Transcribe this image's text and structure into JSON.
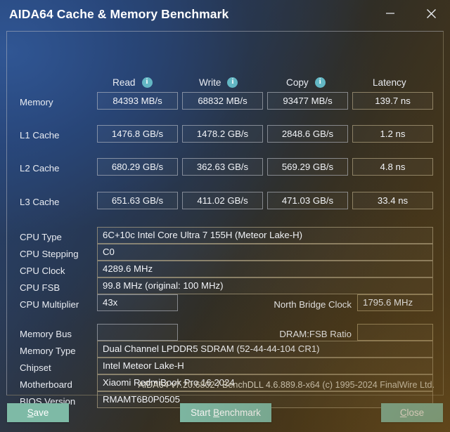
{
  "window": {
    "title": "AIDA64 Cache & Memory Benchmark",
    "minimize_label": "Minimize",
    "close_label": "Close"
  },
  "results_table": {
    "columns": [
      {
        "label": "Read",
        "icon": "info-icon",
        "icon_glyph": "i"
      },
      {
        "label": "Write",
        "icon": "info-icon",
        "icon_glyph": "i"
      },
      {
        "label": "Copy",
        "icon": "info-icon",
        "icon_glyph": "i"
      },
      {
        "label": "Latency",
        "icon": null,
        "icon_glyph": ""
      }
    ],
    "rows": [
      {
        "label": "Memory",
        "read": "84393 MB/s",
        "write": "68832 MB/s",
        "copy": "93477 MB/s",
        "latency": "139.7 ns"
      },
      {
        "label": "L1 Cache",
        "read": "1476.8 GB/s",
        "write": "1478.2 GB/s",
        "copy": "2848.6 GB/s",
        "latency": "1.2 ns"
      },
      {
        "label": "L2 Cache",
        "read": "680.29 GB/s",
        "write": "362.63 GB/s",
        "copy": "569.29 GB/s",
        "latency": "4.8 ns"
      },
      {
        "label": "L3 Cache",
        "read": "651.63 GB/s",
        "write": "411.02 GB/s",
        "copy": "471.03 GB/s",
        "latency": "33.4 ns"
      }
    ]
  },
  "cpu_info": {
    "cpu_type_label": "CPU Type",
    "cpu_type_value": "6C+10c Intel Core Ultra 7 155H  (Meteor Lake-H)",
    "cpu_stepping_label": "CPU Stepping",
    "cpu_stepping_value": "C0",
    "cpu_clock_label": "CPU Clock",
    "cpu_clock_value": "4289.6 MHz",
    "cpu_fsb_label": "CPU FSB",
    "cpu_fsb_value": "99.8 MHz  (original: 100 MHz)",
    "cpu_multiplier_label": "CPU Multiplier",
    "cpu_multiplier_value": "43x",
    "north_bridge_clock_label": "North Bridge Clock",
    "north_bridge_clock_value": "1795.6 MHz"
  },
  "memory_info": {
    "memory_bus_label": "Memory Bus",
    "memory_bus_value": "",
    "dram_fsb_ratio_label": "DRAM:FSB Ratio",
    "dram_fsb_ratio_value": "",
    "memory_type_label": "Memory Type",
    "memory_type_value": "Dual Channel LPDDR5 SDRAM  (52-44-44-104 CR1)",
    "chipset_label": "Chipset",
    "chipset_value": "Intel Meteor Lake-H",
    "motherboard_label": "Motherboard",
    "motherboard_value": "Xiaomi RedmiBook Pro 16 2024",
    "bios_version_label": "BIOS Version",
    "bios_version_value": "RMAMT6B0P0505"
  },
  "footer": {
    "version_text": "AIDA64 v7.20.6802 / BenchDLL 4.6.889.8-x64  (c) 1995-2024 FinalWire Ltd."
  },
  "buttons": {
    "save": {
      "prefix": "",
      "accel": "S",
      "suffix": "ave"
    },
    "start_benchmark": {
      "prefix": "Start ",
      "accel": "B",
      "suffix": "enchmark"
    },
    "close": {
      "prefix": "",
      "accel": "C",
      "suffix": "lose"
    }
  },
  "colors": {
    "accent_button": "#7ebaa6",
    "info_icon": "#63b7c4",
    "text": "#f2f4f8",
    "panel_border": "#babcc4"
  }
}
